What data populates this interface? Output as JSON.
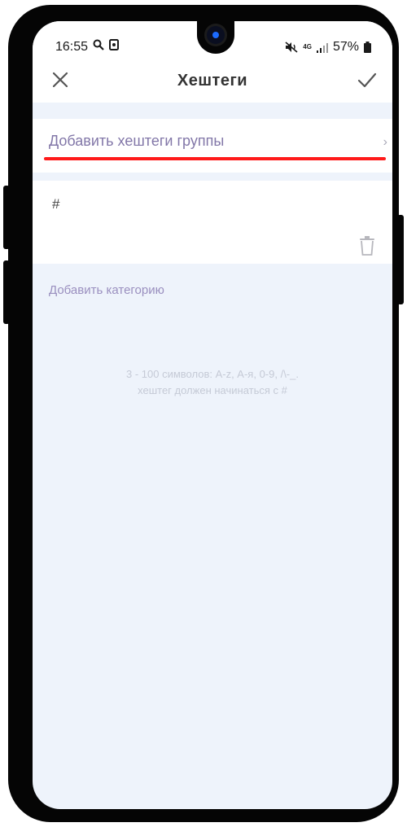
{
  "status_bar": {
    "time": "16:55",
    "battery": "57%",
    "network": "4G"
  },
  "header": {
    "title": "Хештеги"
  },
  "add_group": {
    "label": "Добавить хештеги группы",
    "chevron": "›"
  },
  "hashtag": {
    "value": "#"
  },
  "add_category": {
    "label": "Добавить категорию"
  },
  "hint": {
    "line1": "3 - 100 символов: A-z, А-я, 0-9, /\\-_.",
    "line2": "хештег должен начинаться с #"
  },
  "colors": {
    "accent": "#8277a8",
    "highlight": "#ff1a1a",
    "background": "#eef3fb"
  },
  "icons": [
    "close-icon",
    "check-icon",
    "chevron-right-icon",
    "trash-icon",
    "search-icon",
    "mute-icon",
    "signal-icon",
    "battery-icon"
  ]
}
